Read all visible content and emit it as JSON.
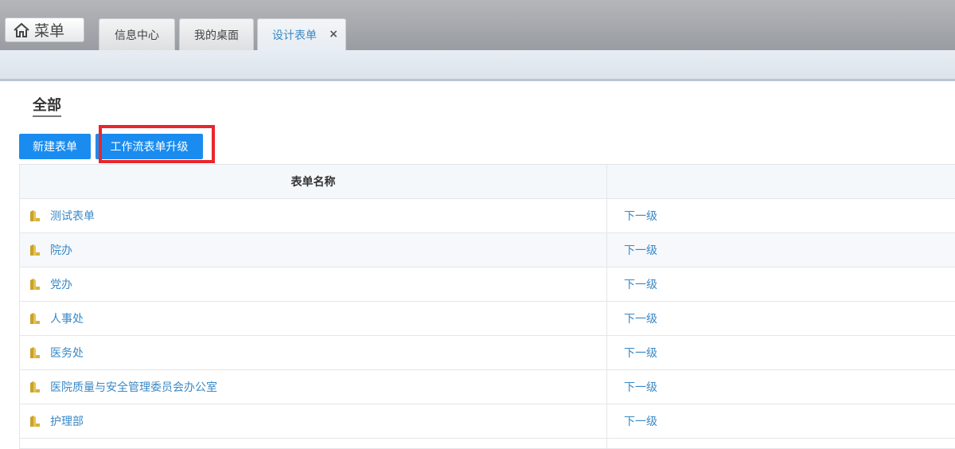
{
  "topbar": {
    "menu_label": "菜单",
    "tabs": [
      {
        "label": "信息中心"
      },
      {
        "label": "我的桌面"
      },
      {
        "label": "设计表单",
        "close": "×"
      }
    ]
  },
  "section": {
    "title": "全部"
  },
  "toolbar": {
    "new_form_label": "新建表单",
    "upgrade_label": "工作流表单升级"
  },
  "table": {
    "headers": [
      "表单名称",
      ""
    ],
    "rows": [
      {
        "name": "测试表单",
        "action": "下一级"
      },
      {
        "name": "院办",
        "action": "下一级"
      },
      {
        "name": "党办",
        "action": "下一级"
      },
      {
        "name": "人事处",
        "action": "下一级"
      },
      {
        "name": "医务处",
        "action": "下一级"
      },
      {
        "name": "医院质量与安全管理委员会办公室",
        "action": "下一级"
      },
      {
        "name": "护理部",
        "action": "下一级"
      }
    ]
  },
  "colors": {
    "primary_button": "#1a8cef",
    "link": "#3a88c5",
    "highlight_box": "#e8262c"
  }
}
